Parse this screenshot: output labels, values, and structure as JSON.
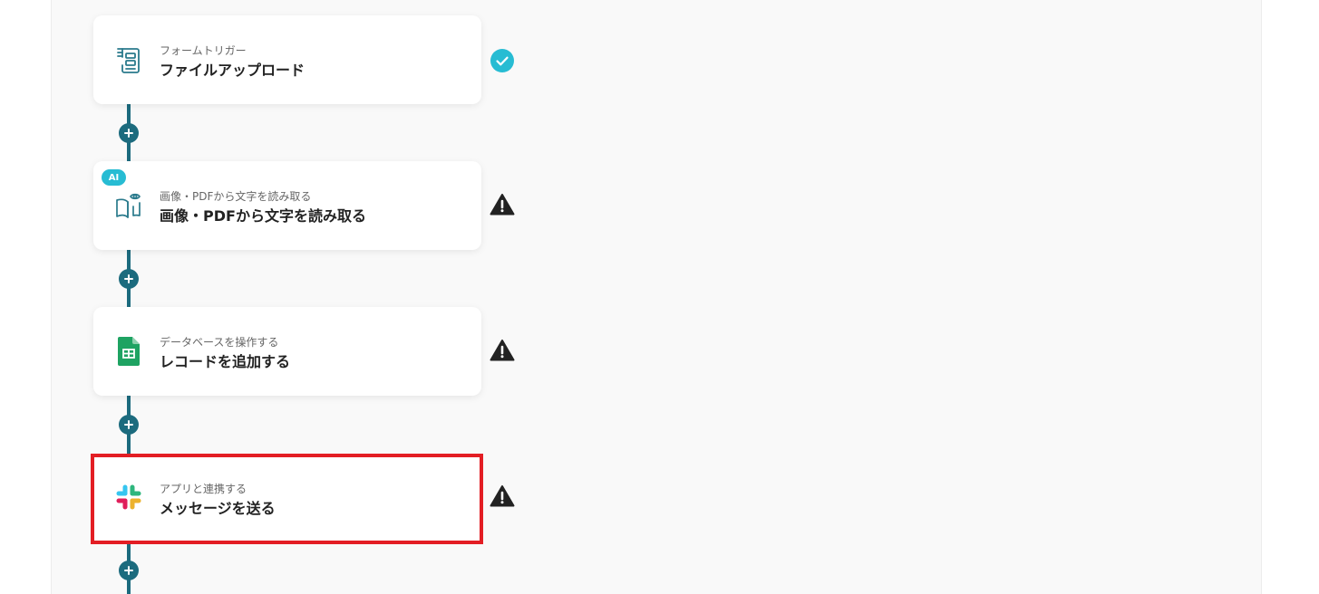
{
  "flow": {
    "steps": [
      {
        "subtitle": "フォームトリガー",
        "title": "ファイルアップロード",
        "icon": "form-icon",
        "status": "complete",
        "status_icon": "check-circle-icon"
      },
      {
        "badge": "AI",
        "subtitle": "画像・PDFから文字を読み取る",
        "title": "画像・PDFから文字を読み取る",
        "icon": "book-eye-icon",
        "status": "warning",
        "status_icon": "warning-icon"
      },
      {
        "subtitle": "データベースを操作する",
        "title": "レコードを追加する",
        "icon": "google-sheets-icon",
        "status": "warning",
        "status_icon": "warning-icon"
      },
      {
        "subtitle": "アプリと連携する",
        "title": "メッセージを送る",
        "icon": "slack-icon",
        "status": "warning",
        "status_icon": "warning-icon",
        "highlighted": true
      }
    ],
    "add_step_icon": "plus-icon"
  },
  "colors": {
    "connector": "#1c6b7e",
    "success": "#27bcd3",
    "warning": "#222222",
    "highlight_border": "#e31e24",
    "ai_badge": "#27bcd3",
    "sheets_green": "#1ea362"
  }
}
